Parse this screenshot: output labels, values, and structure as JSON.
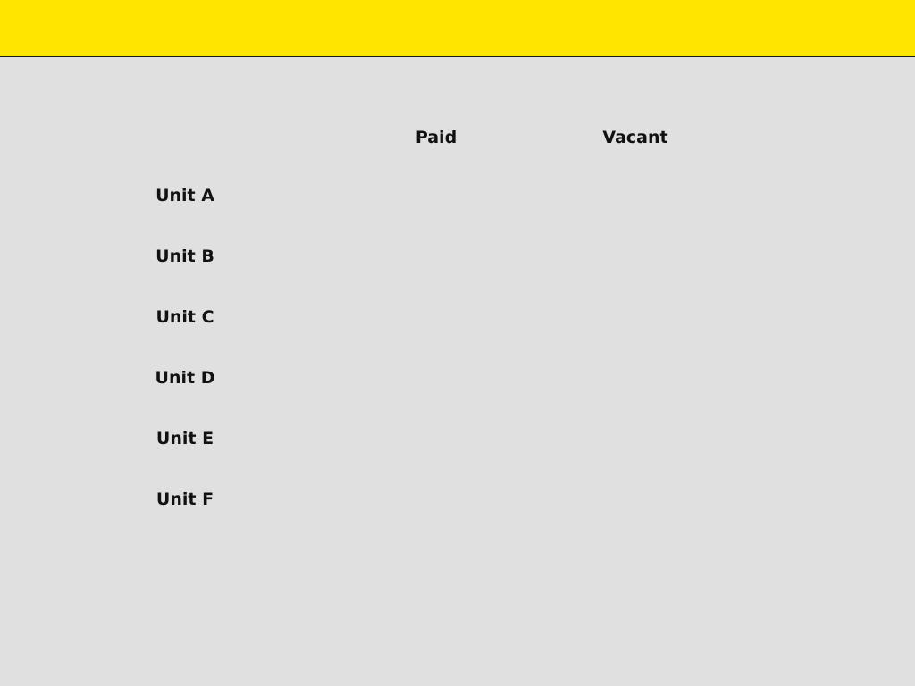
{
  "header": {
    "background_color": "#ffe600"
  },
  "table": {
    "columns": [
      "Paid",
      "Vacant"
    ],
    "rows": [
      "Unit A",
      "Unit B",
      "Unit C",
      "Unit D",
      "Unit E",
      "Unit F"
    ]
  }
}
